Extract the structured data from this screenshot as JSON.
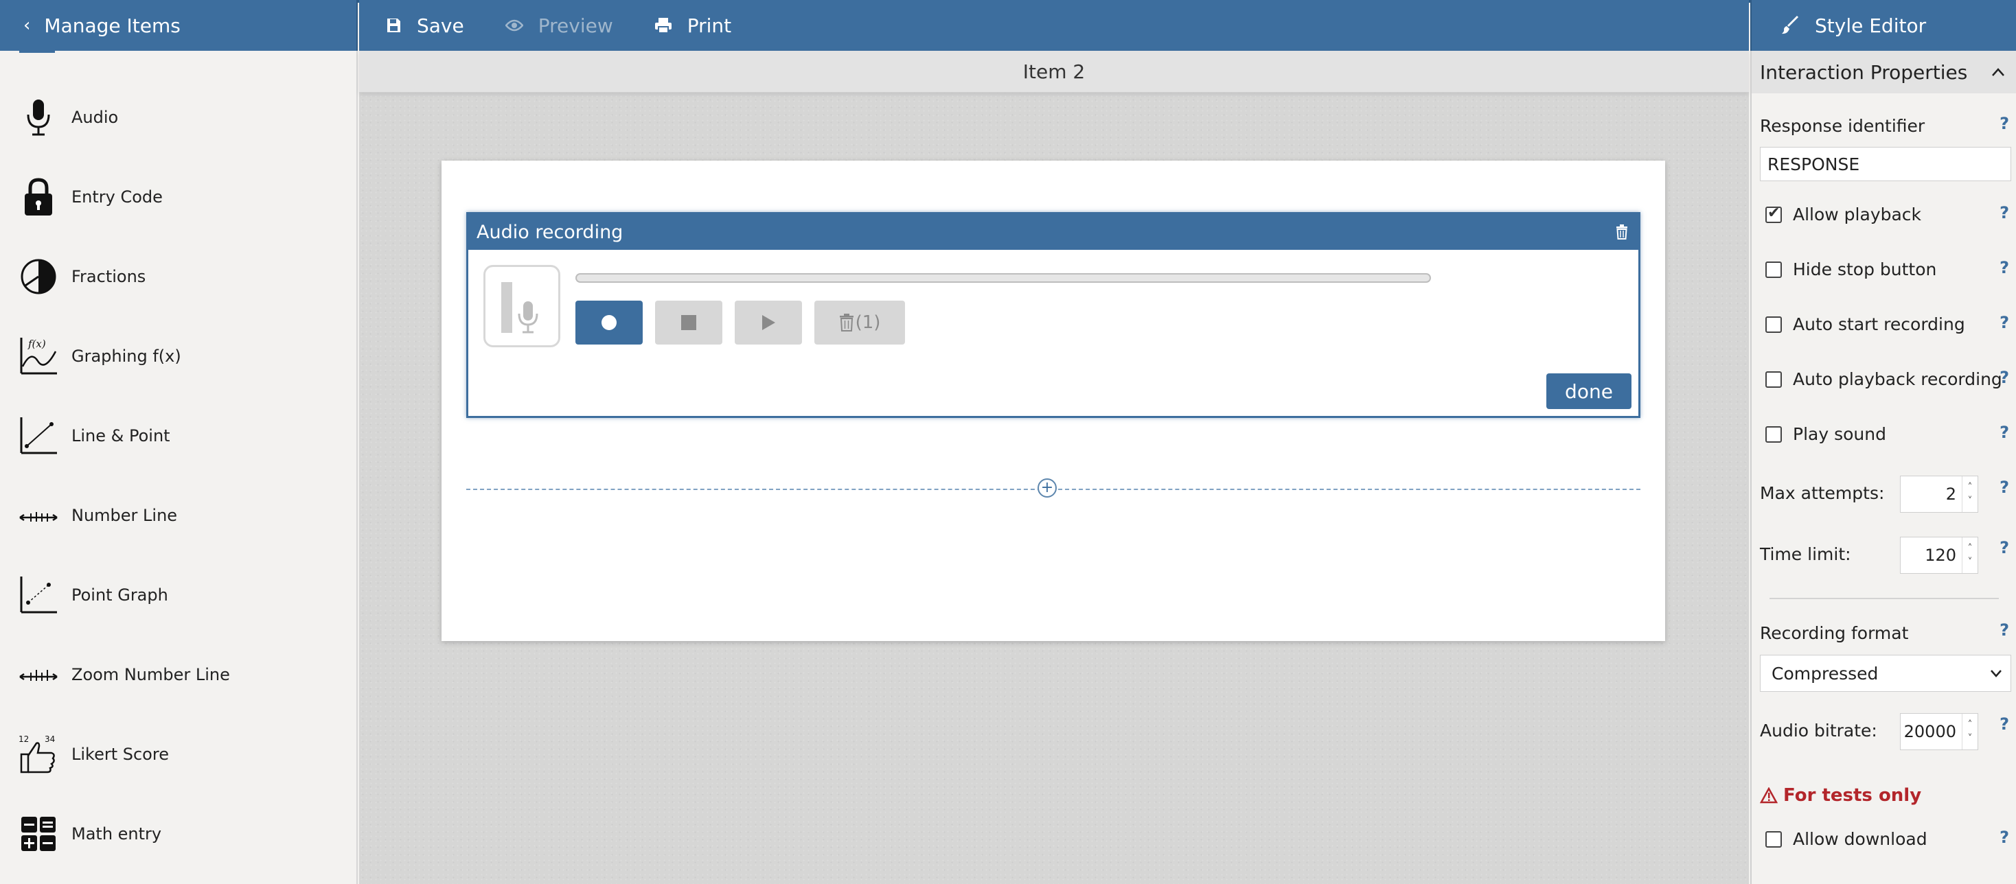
{
  "topbar": {
    "back_label": "Manage Items",
    "save_label": "Save",
    "preview_label": "Preview",
    "print_label": "Print",
    "style_editor_label": "Style Editor"
  },
  "sidebar": {
    "items": [
      {
        "label": "Audio",
        "icon": "microphone-icon"
      },
      {
        "label": "Entry Code",
        "icon": "lock-icon"
      },
      {
        "label": "Fractions",
        "icon": "pie-chart-icon"
      },
      {
        "label": "Graphing f(x)",
        "icon": "function-graph-icon"
      },
      {
        "label": "Line & Point",
        "icon": "line-point-icon"
      },
      {
        "label": "Number Line",
        "icon": "number-line-icon"
      },
      {
        "label": "Point Graph",
        "icon": "point-graph-icon"
      },
      {
        "label": "Zoom Number Line",
        "icon": "zoom-number-line-icon"
      },
      {
        "label": "Likert Score",
        "icon": "thumbs-up-icon"
      },
      {
        "label": "Math entry",
        "icon": "calculator-icon"
      }
    ]
  },
  "canvas": {
    "item_title": "Item 2",
    "widget": {
      "title": "Audio recording",
      "delete_count": "(1)",
      "done_label": "done",
      "progress": 0
    }
  },
  "right_panel": {
    "section_title": "Interaction Properties",
    "response_identifier_label": "Response identifier",
    "response_identifier_value": "RESPONSE",
    "checkboxes": {
      "allow_playback": {
        "label": "Allow playback",
        "checked": true
      },
      "hide_stop_button": {
        "label": "Hide stop button",
        "checked": false
      },
      "auto_start_recording": {
        "label": "Auto start recording",
        "checked": false
      },
      "auto_playback_recording": {
        "label": "Auto playback recording",
        "checked": false
      },
      "play_sound": {
        "label": "Play sound",
        "checked": false
      },
      "allow_download": {
        "label": "Allow download",
        "checked": false
      }
    },
    "max_attempts_label": "Max attempts:",
    "max_attempts_value": "2",
    "time_limit_label": "Time limit:",
    "time_limit_value": "120",
    "recording_format_label": "Recording format",
    "recording_format_value": "Compressed",
    "audio_bitrate_label": "Audio bitrate:",
    "audio_bitrate_value": "20000",
    "tests_only_label": "For tests only",
    "help_glyph": "?"
  },
  "colors": {
    "primary": "#3d6e9e",
    "warning": "#b3262b",
    "panel_bg": "#f3f2f0"
  }
}
